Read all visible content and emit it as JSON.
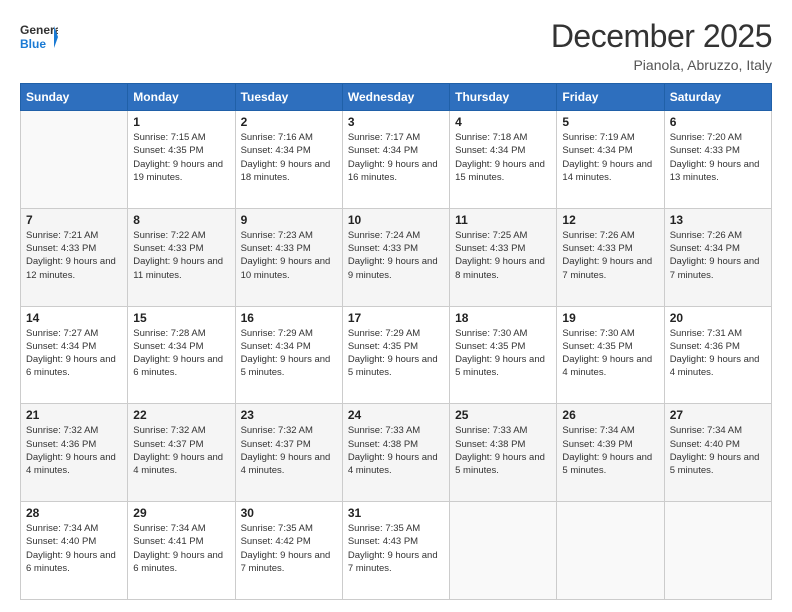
{
  "header": {
    "logo_general": "General",
    "logo_blue": "Blue",
    "month_title": "December 2025",
    "subtitle": "Pianola, Abruzzo, Italy"
  },
  "weekdays": [
    "Sunday",
    "Monday",
    "Tuesday",
    "Wednesday",
    "Thursday",
    "Friday",
    "Saturday"
  ],
  "weeks": [
    [
      {
        "day": "",
        "sunrise": "",
        "sunset": "",
        "daylight": ""
      },
      {
        "day": "1",
        "sunrise": "Sunrise: 7:15 AM",
        "sunset": "Sunset: 4:35 PM",
        "daylight": "Daylight: 9 hours and 19 minutes."
      },
      {
        "day": "2",
        "sunrise": "Sunrise: 7:16 AM",
        "sunset": "Sunset: 4:34 PM",
        "daylight": "Daylight: 9 hours and 18 minutes."
      },
      {
        "day": "3",
        "sunrise": "Sunrise: 7:17 AM",
        "sunset": "Sunset: 4:34 PM",
        "daylight": "Daylight: 9 hours and 16 minutes."
      },
      {
        "day": "4",
        "sunrise": "Sunrise: 7:18 AM",
        "sunset": "Sunset: 4:34 PM",
        "daylight": "Daylight: 9 hours and 15 minutes."
      },
      {
        "day": "5",
        "sunrise": "Sunrise: 7:19 AM",
        "sunset": "Sunset: 4:34 PM",
        "daylight": "Daylight: 9 hours and 14 minutes."
      },
      {
        "day": "6",
        "sunrise": "Sunrise: 7:20 AM",
        "sunset": "Sunset: 4:33 PM",
        "daylight": "Daylight: 9 hours and 13 minutes."
      }
    ],
    [
      {
        "day": "7",
        "sunrise": "Sunrise: 7:21 AM",
        "sunset": "Sunset: 4:33 PM",
        "daylight": "Daylight: 9 hours and 12 minutes."
      },
      {
        "day": "8",
        "sunrise": "Sunrise: 7:22 AM",
        "sunset": "Sunset: 4:33 PM",
        "daylight": "Daylight: 9 hours and 11 minutes."
      },
      {
        "day": "9",
        "sunrise": "Sunrise: 7:23 AM",
        "sunset": "Sunset: 4:33 PM",
        "daylight": "Daylight: 9 hours and 10 minutes."
      },
      {
        "day": "10",
        "sunrise": "Sunrise: 7:24 AM",
        "sunset": "Sunset: 4:33 PM",
        "daylight": "Daylight: 9 hours and 9 minutes."
      },
      {
        "day": "11",
        "sunrise": "Sunrise: 7:25 AM",
        "sunset": "Sunset: 4:33 PM",
        "daylight": "Daylight: 9 hours and 8 minutes."
      },
      {
        "day": "12",
        "sunrise": "Sunrise: 7:26 AM",
        "sunset": "Sunset: 4:33 PM",
        "daylight": "Daylight: 9 hours and 7 minutes."
      },
      {
        "day": "13",
        "sunrise": "Sunrise: 7:26 AM",
        "sunset": "Sunset: 4:34 PM",
        "daylight": "Daylight: 9 hours and 7 minutes."
      }
    ],
    [
      {
        "day": "14",
        "sunrise": "Sunrise: 7:27 AM",
        "sunset": "Sunset: 4:34 PM",
        "daylight": "Daylight: 9 hours and 6 minutes."
      },
      {
        "day": "15",
        "sunrise": "Sunrise: 7:28 AM",
        "sunset": "Sunset: 4:34 PM",
        "daylight": "Daylight: 9 hours and 6 minutes."
      },
      {
        "day": "16",
        "sunrise": "Sunrise: 7:29 AM",
        "sunset": "Sunset: 4:34 PM",
        "daylight": "Daylight: 9 hours and 5 minutes."
      },
      {
        "day": "17",
        "sunrise": "Sunrise: 7:29 AM",
        "sunset": "Sunset: 4:35 PM",
        "daylight": "Daylight: 9 hours and 5 minutes."
      },
      {
        "day": "18",
        "sunrise": "Sunrise: 7:30 AM",
        "sunset": "Sunset: 4:35 PM",
        "daylight": "Daylight: 9 hours and 5 minutes."
      },
      {
        "day": "19",
        "sunrise": "Sunrise: 7:30 AM",
        "sunset": "Sunset: 4:35 PM",
        "daylight": "Daylight: 9 hours and 4 minutes."
      },
      {
        "day": "20",
        "sunrise": "Sunrise: 7:31 AM",
        "sunset": "Sunset: 4:36 PM",
        "daylight": "Daylight: 9 hours and 4 minutes."
      }
    ],
    [
      {
        "day": "21",
        "sunrise": "Sunrise: 7:32 AM",
        "sunset": "Sunset: 4:36 PM",
        "daylight": "Daylight: 9 hours and 4 minutes."
      },
      {
        "day": "22",
        "sunrise": "Sunrise: 7:32 AM",
        "sunset": "Sunset: 4:37 PM",
        "daylight": "Daylight: 9 hours and 4 minutes."
      },
      {
        "day": "23",
        "sunrise": "Sunrise: 7:32 AM",
        "sunset": "Sunset: 4:37 PM",
        "daylight": "Daylight: 9 hours and 4 minutes."
      },
      {
        "day": "24",
        "sunrise": "Sunrise: 7:33 AM",
        "sunset": "Sunset: 4:38 PM",
        "daylight": "Daylight: 9 hours and 4 minutes."
      },
      {
        "day": "25",
        "sunrise": "Sunrise: 7:33 AM",
        "sunset": "Sunset: 4:38 PM",
        "daylight": "Daylight: 9 hours and 5 minutes."
      },
      {
        "day": "26",
        "sunrise": "Sunrise: 7:34 AM",
        "sunset": "Sunset: 4:39 PM",
        "daylight": "Daylight: 9 hours and 5 minutes."
      },
      {
        "day": "27",
        "sunrise": "Sunrise: 7:34 AM",
        "sunset": "Sunset: 4:40 PM",
        "daylight": "Daylight: 9 hours and 5 minutes."
      }
    ],
    [
      {
        "day": "28",
        "sunrise": "Sunrise: 7:34 AM",
        "sunset": "Sunset: 4:40 PM",
        "daylight": "Daylight: 9 hours and 6 minutes."
      },
      {
        "day": "29",
        "sunrise": "Sunrise: 7:34 AM",
        "sunset": "Sunset: 4:41 PM",
        "daylight": "Daylight: 9 hours and 6 minutes."
      },
      {
        "day": "30",
        "sunrise": "Sunrise: 7:35 AM",
        "sunset": "Sunset: 4:42 PM",
        "daylight": "Daylight: 9 hours and 7 minutes."
      },
      {
        "day": "31",
        "sunrise": "Sunrise: 7:35 AM",
        "sunset": "Sunset: 4:43 PM",
        "daylight": "Daylight: 9 hours and 7 minutes."
      },
      {
        "day": "",
        "sunrise": "",
        "sunset": "",
        "daylight": ""
      },
      {
        "day": "",
        "sunrise": "",
        "sunset": "",
        "daylight": ""
      },
      {
        "day": "",
        "sunrise": "",
        "sunset": "",
        "daylight": ""
      }
    ]
  ]
}
